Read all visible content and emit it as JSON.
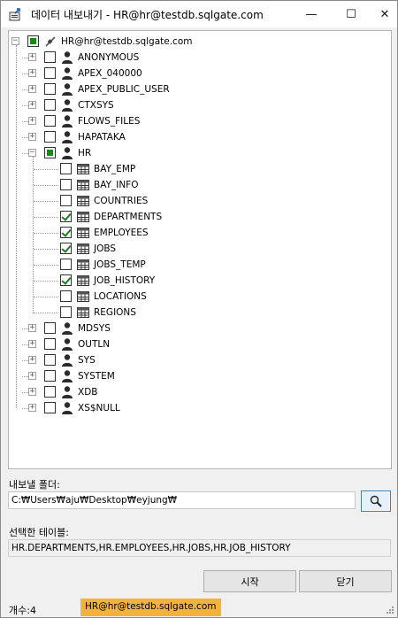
{
  "window": {
    "title": "데이터 내보내기 - HR@hr@testdb.sqlgate.com",
    "minimize": "—",
    "maximize": "☐",
    "close": "✕"
  },
  "tree": {
    "root": {
      "label": "HR@hr@testdb.sqlgate.com",
      "icon": "connection-icon",
      "state": "partial"
    },
    "schemas_before": [
      {
        "label": "ANONYMOUS"
      },
      {
        "label": "APEX_040000"
      },
      {
        "label": "APEX_PUBLIC_USER"
      },
      {
        "label": "CTXSYS"
      },
      {
        "label": "FLOWS_FILES"
      },
      {
        "label": "HAPATAKA"
      }
    ],
    "expanded_schema": {
      "label": "HR",
      "state": "partial"
    },
    "tables": [
      {
        "label": "BAY_EMP",
        "checked": false
      },
      {
        "label": "BAY_INFO",
        "checked": false
      },
      {
        "label": "COUNTRIES",
        "checked": false
      },
      {
        "label": "DEPARTMENTS",
        "checked": true
      },
      {
        "label": "EMPLOYEES",
        "checked": true
      },
      {
        "label": "JOBS",
        "checked": true
      },
      {
        "label": "JOBS_TEMP",
        "checked": false
      },
      {
        "label": "JOB_HISTORY",
        "checked": true
      },
      {
        "label": "LOCATIONS",
        "checked": false
      },
      {
        "label": "REGIONS",
        "checked": false
      }
    ],
    "schemas_after": [
      {
        "label": "MDSYS"
      },
      {
        "label": "OUTLN"
      },
      {
        "label": "SYS"
      },
      {
        "label": "SYSTEM"
      },
      {
        "label": "XDB"
      },
      {
        "label": "XS$NULL"
      }
    ],
    "expand_glyph": "+",
    "collapse_glyph": "−"
  },
  "export": {
    "folder_label": "내보낼 폴더:",
    "folder_value": "C:₩Users₩aju₩Desktop₩eyjung₩",
    "selected_label": "선택한 테이블:",
    "selected_value": "HR.DEPARTMENTS,HR.EMPLOYEES,HR.JOBS,HR.JOB_HISTORY"
  },
  "buttons": {
    "start": "시작",
    "close": "닫기"
  },
  "status": {
    "count": "개수:4",
    "connection": "HR@hr@testdb.sqlgate.com",
    "connection_color": "#f2b23c"
  }
}
